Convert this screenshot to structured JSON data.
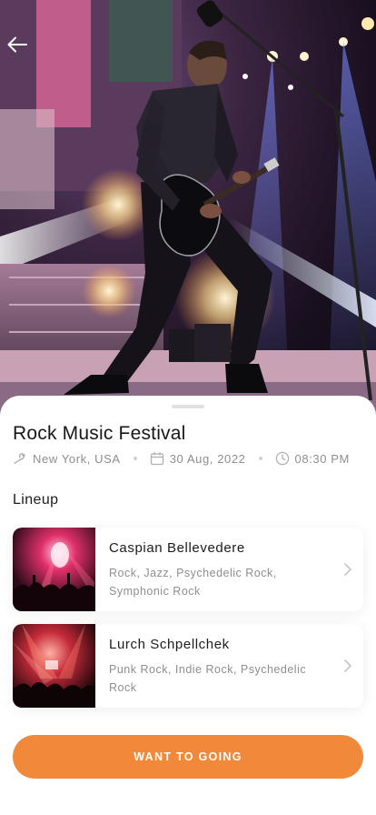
{
  "event": {
    "title": "Rock Music Festival",
    "location": "New York, USA",
    "date": "30 Aug, 2022",
    "time": "08:30 PM"
  },
  "lineup": {
    "title": "Lineup",
    "artists": [
      {
        "name": "Caspian Bellevedere",
        "genres": "Rock, Jazz, Psychedelic Rock, Symphonic Rock"
      },
      {
        "name": "Lurch Schpellchek",
        "genres": "Punk Rock, Indie Rock, Psychedelic Rock"
      }
    ]
  },
  "cta": {
    "label": "WANT TO GOING"
  },
  "colors": {
    "accent": "#f08a3a",
    "muted_text": "#8e8e93"
  },
  "icons": [
    "back-arrow-icon",
    "location-icon",
    "calendar-icon",
    "clock-icon",
    "chevron-right-icon"
  ]
}
